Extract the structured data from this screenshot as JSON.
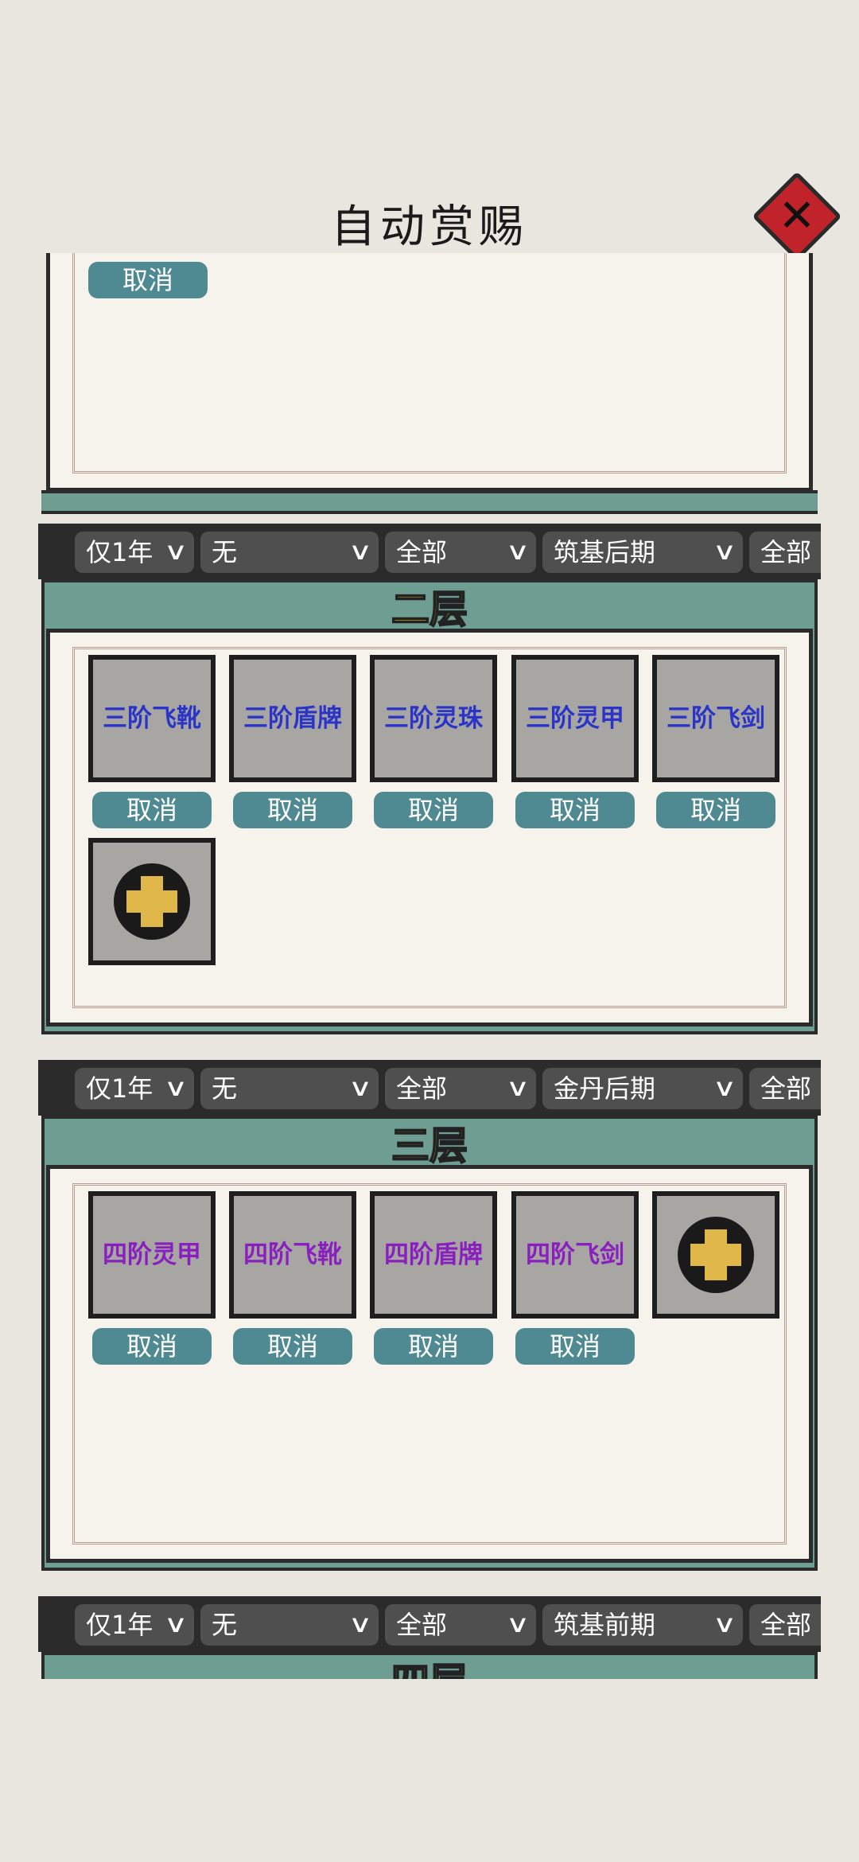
{
  "header": {
    "title": "自动赏赐",
    "close_icon": "close-icon"
  },
  "top_panel": {
    "cancel_label": "取消"
  },
  "filter_rows": [
    {
      "duration": "仅1年",
      "type": "无",
      "scope": "全部",
      "realm": "筑基后期",
      "target": "全部"
    },
    {
      "duration": "仅1年",
      "type": "无",
      "scope": "全部",
      "realm": "金丹后期",
      "target": "全部"
    },
    {
      "duration": "仅1年",
      "type": "无",
      "scope": "全部",
      "realm": "筑基前期",
      "target": "全部"
    }
  ],
  "layers": [
    {
      "name": "二层",
      "items": [
        "三阶飞靴",
        "三阶盾牌",
        "三阶灵珠",
        "三阶灵甲",
        "三阶飞剑"
      ],
      "cancel_label": "取消"
    },
    {
      "name": "三层",
      "items": [
        "四阶灵甲",
        "四阶飞靴",
        "四阶盾牌",
        "四阶飞剑"
      ],
      "cancel_label": "取消"
    },
    {
      "name": "四层"
    }
  ],
  "colors": {
    "teal": "#6e9e91",
    "cancel": "#4f8a93",
    "layer_title": "#f7e020",
    "tier3_text": "#2a35c8",
    "tier4_text": "#8a1fbf"
  }
}
